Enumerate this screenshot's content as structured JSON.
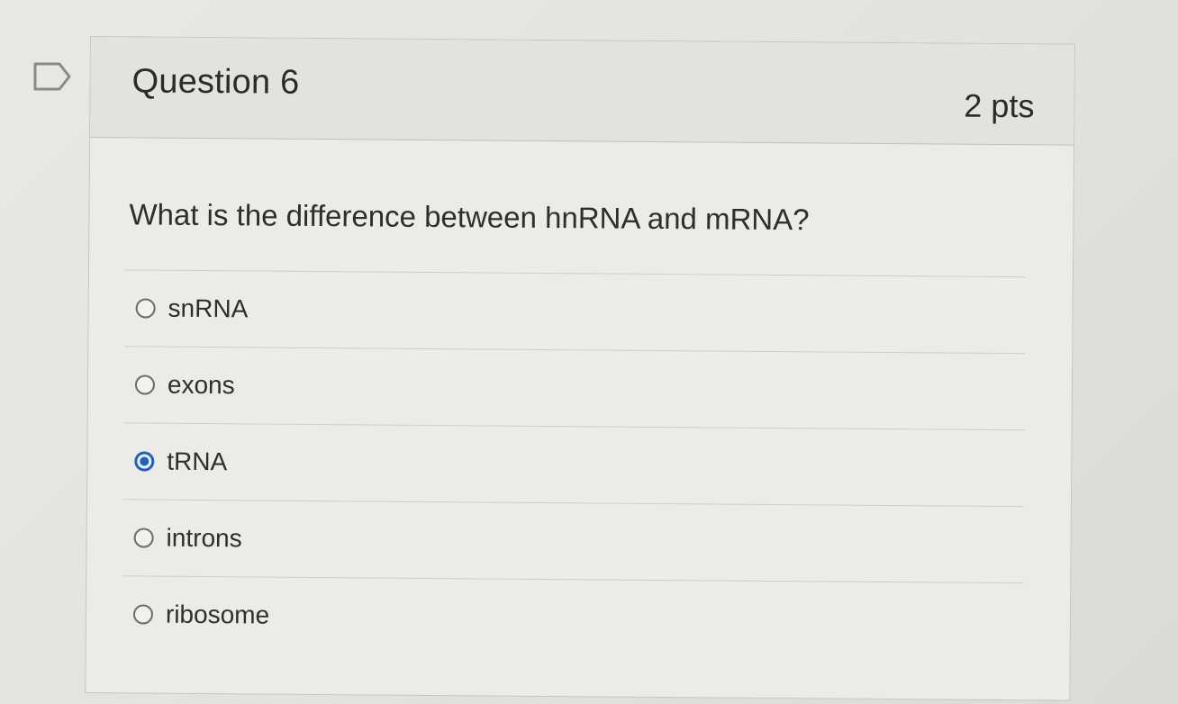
{
  "question": {
    "title": "Question 6",
    "points": "2 pts",
    "text": "What is the difference between hnRNA and mRNA?"
  },
  "answers": [
    {
      "label": "snRNA",
      "selected": false
    },
    {
      "label": "exons",
      "selected": false
    },
    {
      "label": "tRNA",
      "selected": true
    },
    {
      "label": "introns",
      "selected": false
    },
    {
      "label": "ribosome",
      "selected": false
    }
  ],
  "colors": {
    "selected_radio": "#1f5fc2"
  },
  "icons": {
    "flag": "flag-icon"
  }
}
